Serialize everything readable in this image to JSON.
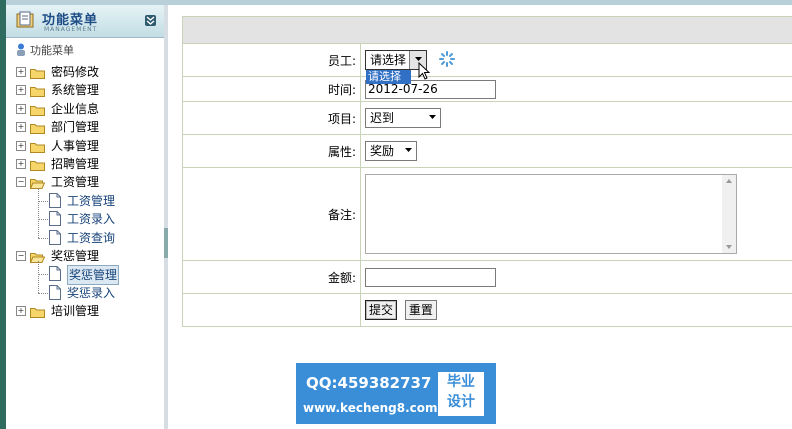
{
  "sidebar": {
    "title": "功能菜单",
    "subtitle": "MANAGEMENT",
    "root_label": "功能菜单",
    "items": [
      {
        "label": "密码修改",
        "expanded": false
      },
      {
        "label": "系统管理",
        "expanded": false
      },
      {
        "label": "企业信息",
        "expanded": false
      },
      {
        "label": "部门管理",
        "expanded": false
      },
      {
        "label": "人事管理",
        "expanded": false
      },
      {
        "label": "招聘管理",
        "expanded": false
      },
      {
        "label": "工资管理",
        "expanded": true,
        "children": [
          "工资管理",
          "工资录入",
          "工资查询"
        ]
      },
      {
        "label": "奖惩管理",
        "expanded": true,
        "children": [
          "奖惩管理",
          "奖惩录入"
        ],
        "selected_child": "奖惩管理"
      },
      {
        "label": "培训管理",
        "expanded": false
      }
    ]
  },
  "form": {
    "employee_label": "员工:",
    "employee_value": "请选择",
    "employee_dropdown_option": "请选择",
    "time_label": "时间:",
    "time_value": "2012-07-26",
    "project_label": "项目:",
    "project_value": "迟到",
    "attribute_label": "属性:",
    "attribute_value": "奖励",
    "remark_label": "备注:",
    "remark_value": "",
    "amount_label": "金额:",
    "amount_value": "",
    "submit_label": "提交",
    "reset_label": "重置"
  },
  "watermark": {
    "qq": "QQ:459382737",
    "site": "www.kecheng8.com",
    "badge_line1": "毕业",
    "badge_line2": "设计"
  },
  "colors": {
    "accent": "#3170c4",
    "watermark_bg": "#3a8ed8",
    "header_band": "#e3e3e3",
    "table_border": "#c8d3b8"
  }
}
